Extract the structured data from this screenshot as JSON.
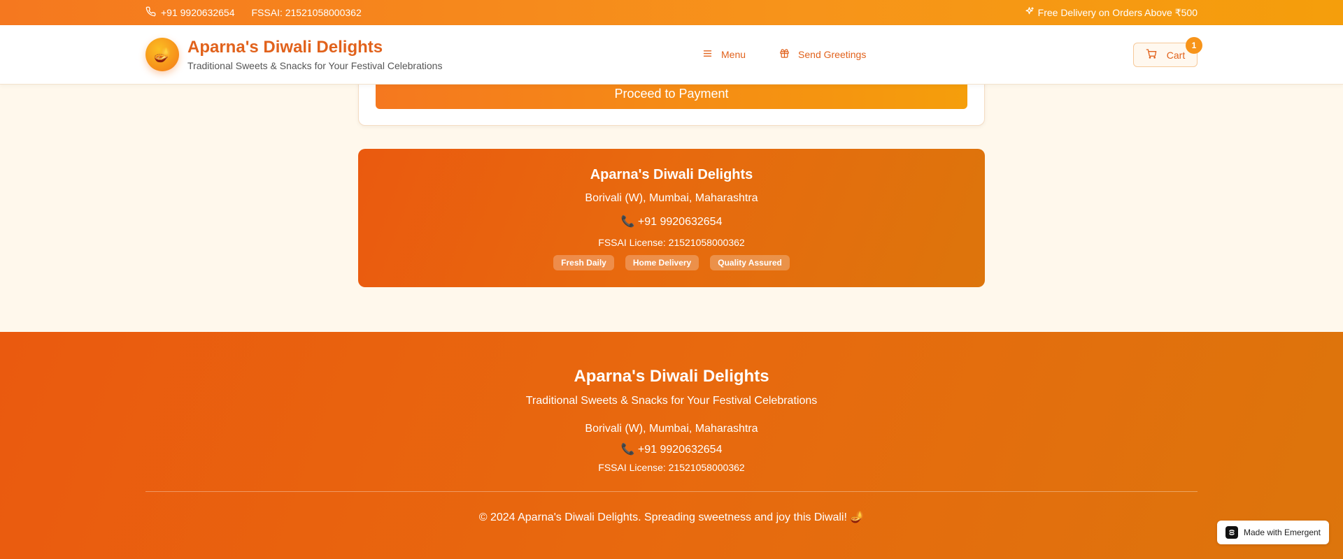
{
  "topbar": {
    "phone": "+91 9920632654",
    "fssai": "FSSAI: 21521058000362",
    "promo": "Free Delivery on Orders Above ₹500"
  },
  "header": {
    "logo_emoji": "🪔",
    "title": "Aparna's Diwali Delights",
    "subtitle": "Traditional Sweets & Snacks for Your Festival Celebrations",
    "nav": [
      {
        "label": "Menu",
        "icon": "menu-icon"
      },
      {
        "label": "Send Greetings",
        "icon": "gift-icon"
      }
    ],
    "cart": {
      "label": "Cart",
      "count": "1",
      "icon": "cart-icon"
    }
  },
  "checkout": {
    "pay_label": "Proceed to Payment"
  },
  "info_card": {
    "name": "Aparna's Diwali Delights",
    "address": "Borivali (W), Mumbai, Maharashtra",
    "phone": "📞 +91 9920632654",
    "fssai": "FSSAI License: 21521058000362",
    "badges": [
      "Fresh Daily",
      "Home Delivery",
      "Quality Assured"
    ]
  },
  "footer": {
    "name": "Aparna's Diwali Delights",
    "tagline": "Traditional Sweets & Snacks for Your Festival Celebrations",
    "address": "Borivali (W), Mumbai, Maharashtra",
    "phone": "📞 +91 9920632654",
    "fssai": "FSSAI License: 21521058000362",
    "copyright": "© 2024 Aparna's Diwali Delights. Spreading sweetness and joy this Diwali! 🪔"
  },
  "emergent_badge": {
    "label": "Made with Emergent"
  },
  "colors": {
    "brand_orange": "#e1621c",
    "accent": "#f7941a",
    "background": "#fff8ec"
  }
}
